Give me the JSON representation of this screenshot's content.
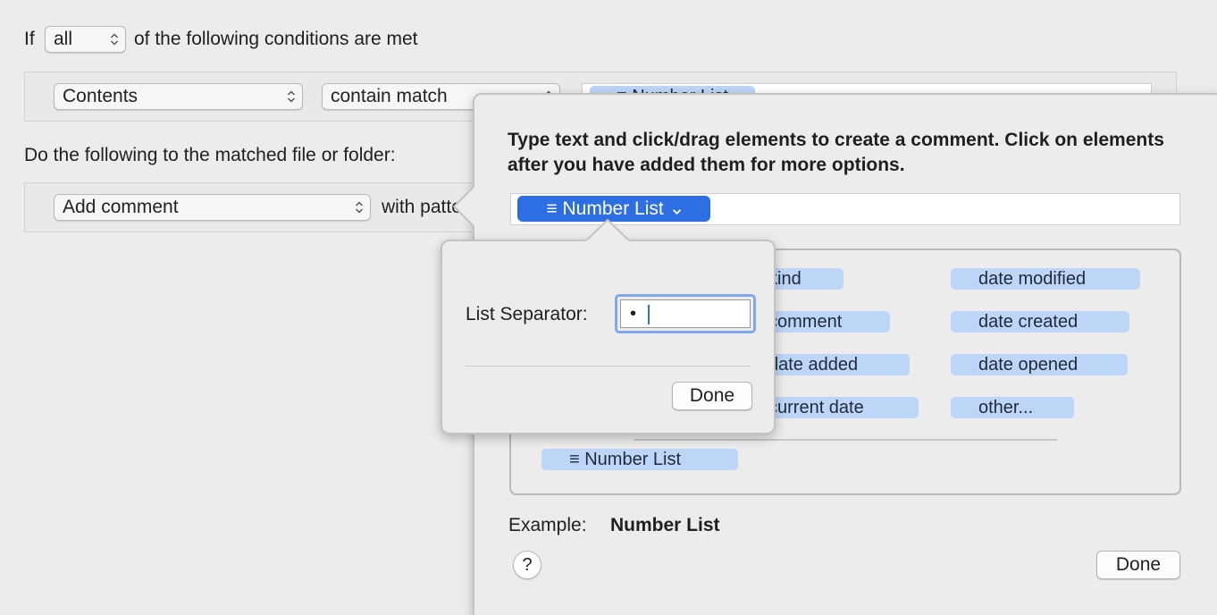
{
  "conditions": {
    "prefix": "If",
    "match_mode": "all",
    "suffix": "of the following conditions are met",
    "row": {
      "attribute": "Contents",
      "operator": "contain match",
      "token_label": "≡ Number List"
    }
  },
  "actions": {
    "heading": "Do the following to the matched file or folder:",
    "row": {
      "action": "Add comment",
      "with_text": "with pattern"
    }
  },
  "comment_panel": {
    "instructions": "Type text and click/drag elements to create a comment. Click on elements after you have added them for more options.",
    "selected_token": "≡ Number List",
    "elements": {
      "col1": [
        "kind",
        "comment",
        "date added",
        "current date"
      ],
      "col2": [
        "date modified",
        "date created",
        "date opened",
        "other..."
      ],
      "number_list": "≡ Number List"
    },
    "example_label": "Example:",
    "example_value": "Number List",
    "help_label": "?",
    "done_label": "Done"
  },
  "separator_popover": {
    "label": "List Separator:",
    "value": "•",
    "done_label": "Done"
  },
  "colors": {
    "accent": "#2d6fe3",
    "token_bg": "#bdd5f7"
  }
}
